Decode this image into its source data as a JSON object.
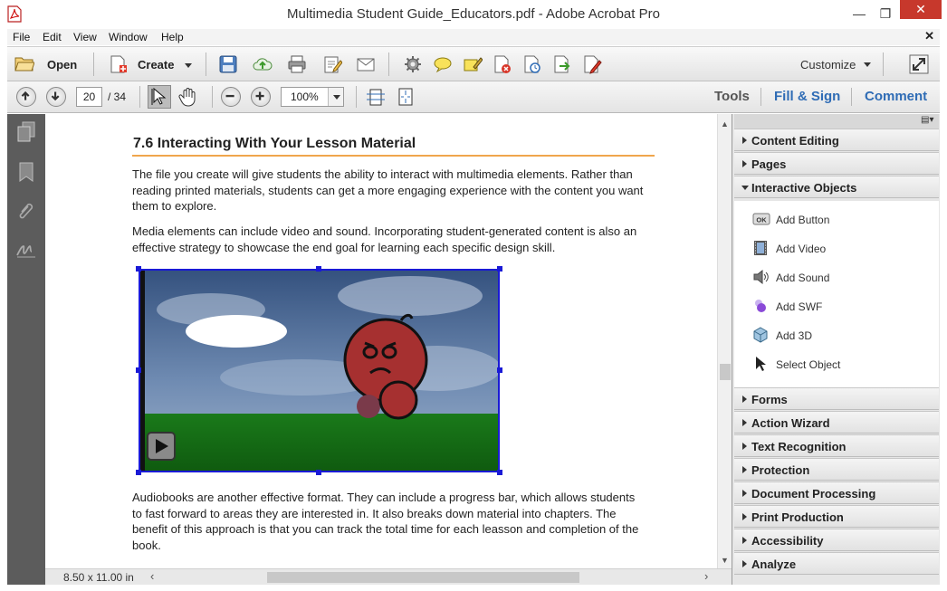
{
  "window": {
    "title": "Multimedia Student Guide_Educators.pdf - Adobe Acrobat Pro"
  },
  "menu": {
    "items": [
      "File",
      "Edit",
      "View",
      "Window",
      "Help"
    ]
  },
  "toolbar": {
    "open_label": "Open",
    "create_label": "Create",
    "customize_label": "Customize"
  },
  "nav": {
    "page_current": "20",
    "page_total": "/ 34",
    "zoom": "100%"
  },
  "pane_tabs": {
    "tools": "Tools",
    "fill_sign": "Fill & Sign",
    "comment": "Comment"
  },
  "document": {
    "heading": "7.6 Interacting With Your Lesson Material",
    "para1": "The file you create will give students the ability to interact with multimedia elements. Rather than reading printed materials, students can get a more engaging experience with the content you want them to explore.",
    "para2": "Media elements can include video and sound.  Incorporating student-generated content is also an effective strategy to showcase the  end goal for learning each specific design skill.",
    "para3": "Audiobooks are another effective format. They can include a progress bar, which allows students to fast forward to areas they are interested in. It also breaks down material into chapters. The benefit of this approach is that you can track the total time for each leasson and completion of the book."
  },
  "status": {
    "page_size": "8.50 x 11.00 in"
  },
  "panels": {
    "content_editing": "Content Editing",
    "pages": "Pages",
    "interactive_objects": "Interactive Objects",
    "forms": "Forms",
    "action_wizard": "Action Wizard",
    "text_recognition": "Text Recognition",
    "protection": "Protection",
    "document_processing": "Document Processing",
    "print_production": "Print Production",
    "accessibility": "Accessibility",
    "analyze": "Analyze"
  },
  "interactive_items": [
    "Add Button",
    "Add Video",
    "Add Sound",
    "Add SWF",
    "Add 3D",
    "Select Object"
  ],
  "colors": {
    "accent_blue": "#2f6cb5",
    "heading_rule": "#f0a64c",
    "selection": "#1a1ad6"
  },
  "icons": [
    "pdf-app-icon",
    "open-folder-icon",
    "create-icon",
    "save-icon",
    "upload-cloud-icon",
    "print-icon",
    "edit-icon",
    "mail-icon",
    "gear-icon",
    "comment-bubble-icon",
    "highlight-icon",
    "redact-icon",
    "stamp-icon",
    "export-icon",
    "sign-icon",
    "full-screen-icon"
  ]
}
